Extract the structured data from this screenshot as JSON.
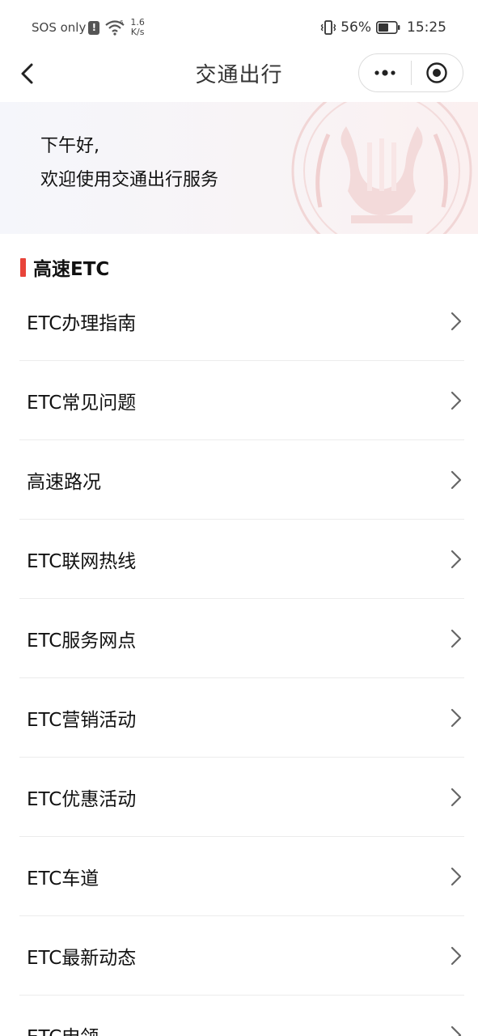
{
  "status_bar": {
    "sos": "SOS only",
    "alert": "!",
    "speed_value": "1.6",
    "speed_unit": "K/s",
    "battery_pct": "56%",
    "time": "15:25"
  },
  "nav": {
    "title": "交通出行"
  },
  "banner": {
    "greeting_line1": "下午好,",
    "greeting_line2": "欢迎使用交通出行服务"
  },
  "section": {
    "title": "高速ETC"
  },
  "list": {
    "items": [
      {
        "label": "ETC办理指南"
      },
      {
        "label": "ETC常见问题"
      },
      {
        "label": "高速路况"
      },
      {
        "label": "ETC联网热线"
      },
      {
        "label": "ETC服务网点"
      },
      {
        "label": "ETC营销活动"
      },
      {
        "label": "ETC优惠活动"
      },
      {
        "label": "ETC车道"
      },
      {
        "label": "ETC最新动态"
      },
      {
        "label": "ETC申领"
      }
    ]
  },
  "colors": {
    "accent": "#e8443a",
    "divider": "#ececec",
    "chevron": "#666666"
  }
}
